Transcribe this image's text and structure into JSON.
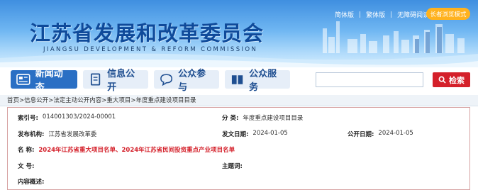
{
  "site": {
    "title": "江苏省发展和改革委员会",
    "subtitle": "JIANGSU DEVELOPMENT & REFORM COMMISSION",
    "top_links": [
      "简体版",
      "繁体版",
      "无障碍阅读"
    ],
    "care_mode": "长者浏览模式"
  },
  "nav": {
    "items": [
      {
        "label": "新闻动态",
        "icon": "news-icon"
      },
      {
        "label": "信息公开",
        "icon": "document-icon"
      },
      {
        "label": "公众参与",
        "icon": "chat-icon"
      },
      {
        "label": "公众服务",
        "icon": "service-icon"
      }
    ],
    "search_button": "检索"
  },
  "breadcrumb": "首页>信息公开>法定主动公开内容>重大项目>年度重点建设项目目录",
  "info": {
    "index_label": "索引号:",
    "index_value": "014001303/2024-00001",
    "category_label": "分 类:",
    "category_value": "年度重点建设项目目录",
    "publisher_label": "发布机构:",
    "publisher_value": "江苏省发展改革委",
    "issue_date_label": "发文日期:",
    "issue_date_value": "2024-01-05",
    "public_date_label": "公开日期:",
    "public_date_value": "2024-01-05",
    "name_label": "名 称:",
    "name_value": "2024年江苏省重大项目名单、2024年江苏省民间投资重点产业项目名单",
    "docno_label": "文 号:",
    "keywords_label": "主题词:",
    "summary_label": "内容概述:"
  }
}
